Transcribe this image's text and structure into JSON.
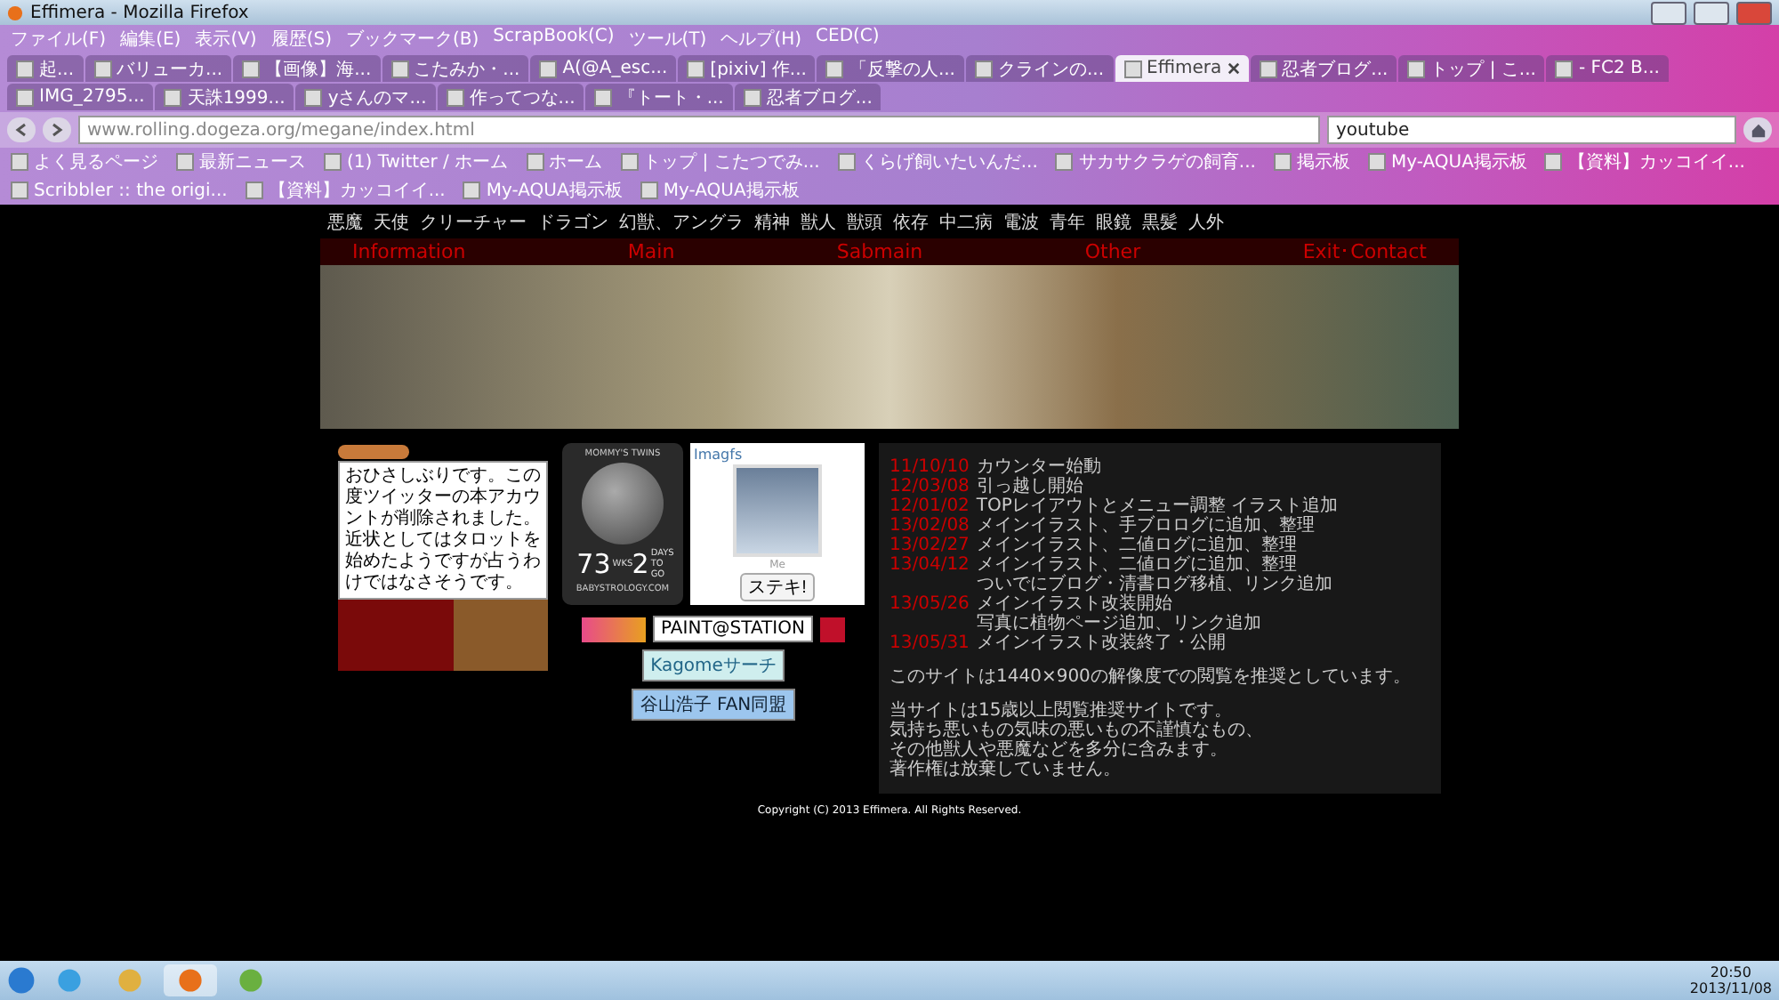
{
  "window": {
    "title": "Effimera - Mozilla Firefox"
  },
  "menu": [
    "ファイル(F)",
    "編集(E)",
    "表示(V)",
    "履歴(S)",
    "ブックマーク(B)",
    "ScrapBook(C)",
    "ツール(T)",
    "ヘルプ(H)",
    "CED(C)"
  ],
  "tabs": [
    {
      "label": "起...",
      "selected": false
    },
    {
      "label": "バリューカ...",
      "selected": false
    },
    {
      "label": "【画像】海...",
      "selected": false
    },
    {
      "label": "こたみか・...",
      "selected": false
    },
    {
      "label": "A(@A_esc...",
      "selected": false
    },
    {
      "label": "[pixiv] 作...",
      "selected": false
    },
    {
      "label": "「反撃の人...",
      "selected": false
    },
    {
      "label": "クラインの...",
      "selected": false
    },
    {
      "label": "Effimera",
      "selected": true
    },
    {
      "label": "忍者ブログ...",
      "selected": false
    },
    {
      "label": "トップ | こ...",
      "selected": false
    },
    {
      "label": "- FC2 B...",
      "selected": false
    },
    {
      "label": "IMG_2795...",
      "selected": false
    },
    {
      "label": "天誅1999...",
      "selected": false
    },
    {
      "label": "yさんのマ...",
      "selected": false
    },
    {
      "label": "作ってつな...",
      "selected": false
    },
    {
      "label": "『トート・...",
      "selected": false
    },
    {
      "label": "忍者ブログ...",
      "selected": false
    }
  ],
  "url": "www.rolling.dogeza.org/megane/index.html",
  "search": "youtube",
  "bookmarks": [
    "よく見るページ",
    "最新ニュース",
    "(1) Twitter / ホーム",
    "ホーム",
    "トップ | こたつでみ...",
    "くらげ飼いたいんだ...",
    "サカサクラゲの飼育...",
    "掲示板",
    "My-AQUA掲示板",
    "【資料】カッコイイ...",
    "Scribbler :: the origi...",
    "【資料】カッコイイ...",
    "My-AQUA掲示板",
    "My-AQUA掲示板"
  ],
  "page": {
    "genres": [
      "悪魔",
      "天使",
      "クリーチャー",
      "ドラゴン",
      "幻獣、アングラ",
      "精神",
      "獣人",
      "獣頭",
      "依存",
      "中二病",
      "電波",
      "青年",
      "眼鏡",
      "黒髪",
      "人外"
    ],
    "nav": [
      "Information",
      "Main",
      "Sabmain",
      "Other",
      "Exit･Contact"
    ],
    "speech": "おひさしぶりです。この度ツイッターの本アカウントが削除されました。近状としてはタロットを始めたようですが占うわけではなさそうです。",
    "widget": {
      "title": "MOMMY'S TWINS",
      "weeks": "73",
      "weeks_unit": "WKS",
      "days": "2",
      "days_unit": "DAYS TO GO",
      "site": "BABYSTROLOGY.COM"
    },
    "gallery": {
      "title": "Imagfs",
      "caption": "Me",
      "button": "ステキ!"
    },
    "banners": [
      "PAINT@STATION",
      "Kagomeサーチ",
      "谷山浩子 FAN同盟"
    ],
    "news": [
      {
        "date": "11/10/10",
        "lines": [
          "カウンター始動"
        ]
      },
      {
        "date": "12/03/08",
        "lines": [
          "引っ越し開始"
        ]
      },
      {
        "date": "12/01/02",
        "lines": [
          "TOPレイアウトとメニュー調整 イラスト追加"
        ]
      },
      {
        "date": "13/02/08",
        "lines": [
          "メインイラスト、手ブロログに追加、整理"
        ]
      },
      {
        "date": "13/02/27",
        "lines": [
          "メインイラスト、二値ログに追加、整理"
        ]
      },
      {
        "date": "13/04/12",
        "lines": [
          "メインイラスト、二値ログに追加、整理",
          "ついでにブログ・清書ログ移植、リンク追加"
        ]
      },
      {
        "date": "13/05/26",
        "lines": [
          "メインイラスト改装開始",
          "写真に植物ページ追加、リンク追加"
        ]
      },
      {
        "date": "13/05/31",
        "lines": [
          "メインイラスト改装終了・公開"
        ]
      }
    ],
    "resolution": "このサイトは1440×900の解像度での閲覧を推奨としています。",
    "notice": [
      "当サイトは15歳以上閲覧推奨サイトです。",
      "気持ち悪いもの気味の悪いもの不謹慎なもの、",
      "その他獣人や悪魔などを多分に含みます。",
      "著作権は放棄していません。"
    ],
    "footer": "Copyright (C) 2013 Effimera. All Rights Reserved."
  },
  "taskbar": {
    "time": "20:50",
    "date": "2013/11/08"
  }
}
